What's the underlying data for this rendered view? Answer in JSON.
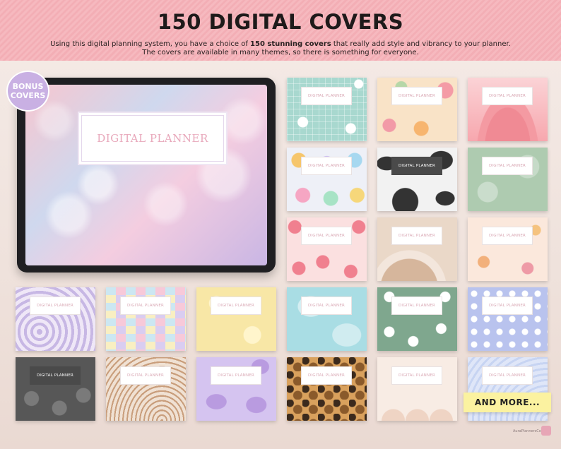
{
  "header": {
    "title": "150 DIGITAL COVERS",
    "subtitle_before": "Using this digital planning system, you have a choice of ",
    "subtitle_bold": "150 stunning covers",
    "subtitle_after": " that really add style and vibrancy to your planner.",
    "subtitle_line2": "The covers are available in many themes, so there is something for everyone."
  },
  "badge": {
    "line1": "BONUS",
    "line2": "COVERS"
  },
  "tablet": {
    "label": "DIGITAL PLANNER"
  },
  "covers": [
    {
      "label": "DIGITAL PLANNER",
      "theme": "mint-daisy"
    },
    {
      "label": "DIGITAL PLANNER",
      "theme": "peach-floral"
    },
    {
      "label": "DIGITAL PLANNER",
      "theme": "pink-waves"
    },
    {
      "label": "DIGITAL PLANNER",
      "theme": "pastel-smileys"
    },
    {
      "label": "DIGITAL PLANNER",
      "theme": "cow-print"
    },
    {
      "label": "DIGITAL PLANNER",
      "theme": "sage-floral"
    },
    {
      "label": "DIGITAL PLANNER",
      "theme": "pink-hearts"
    },
    {
      "label": "DIGITAL PLANNER",
      "theme": "boho-leaf"
    },
    {
      "label": "DIGITAL PLANNER",
      "theme": "butterflies"
    },
    {
      "label": "DIGITAL PLANNER",
      "theme": "lilac-swirl"
    },
    {
      "label": "DIGITAL PLANNER",
      "theme": "pastel-check"
    },
    {
      "label": "DIGITAL PLANNER",
      "theme": "yellow-floral"
    },
    {
      "label": "DIGITAL PLANNER",
      "theme": "aqua-water"
    },
    {
      "label": "DIGITAL PLANNER",
      "theme": "green-daisy"
    },
    {
      "label": "DIGITAL PLANNER",
      "theme": "blue-flower"
    },
    {
      "label": "DIGITAL PLANNER",
      "theme": "grey-bears"
    },
    {
      "label": "DIGITAL PLANNER",
      "theme": "beige-lines"
    },
    {
      "label": "DIGITAL PLANNER",
      "theme": "lilac-monstera"
    },
    {
      "label": "DIGITAL PLANNER",
      "theme": "leopard"
    },
    {
      "label": "DIGITAL PLANNER",
      "theme": "blush-arches"
    },
    {
      "label": "DIGITAL PLANNER",
      "theme": "blue-rainbow"
    }
  ],
  "more_label": "AND MORE...",
  "brand": "AuraPlannersCo"
}
